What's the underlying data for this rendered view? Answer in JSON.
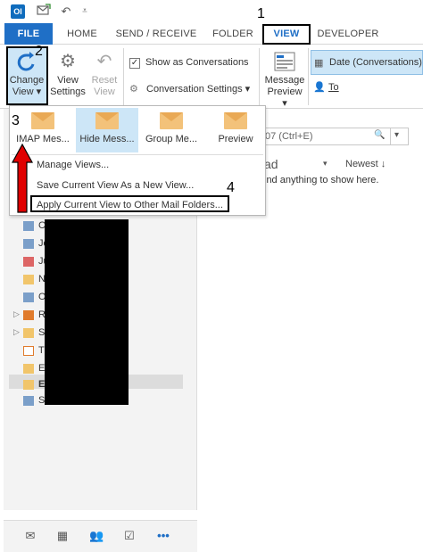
{
  "app": {
    "icon_label": "Ol"
  },
  "quick_access": {
    "undo_glyph": "↶",
    "customize_glyph": "⩡"
  },
  "tabs": [
    {
      "label": "FILE"
    },
    {
      "label": "HOME"
    },
    {
      "label": "SEND / RECEIVE"
    },
    {
      "label": "FOLDER"
    },
    {
      "label": "VIEW"
    },
    {
      "label": "DEVELOPER"
    }
  ],
  "ribbon": {
    "change_view": "Change View ▾",
    "view_settings": "View Settings",
    "reset_view": "Reset View",
    "show_as_conversations": "Show as Conversations",
    "conversation_settings": "Conversation Settings ▾",
    "message_preview": "Message Preview ▾",
    "arrangement_date": "Date (Conversations)",
    "arrangement_to": "To"
  },
  "dropdown": {
    "gallery": [
      {
        "label": "IMAP Mes..."
      },
      {
        "label": "Hide Mess..."
      },
      {
        "label": "Group Me..."
      },
      {
        "label": "Preview"
      }
    ],
    "manage_views": "Manage Views...",
    "save_current_view": "Save Current View As a New View...",
    "apply_current_view": "Apply Current View to Other Mail Folders..."
  },
  "message_list": {
    "search_placeholder": "07 (Ctrl+E)",
    "search_icon": "🔍",
    "sort_label": "ad",
    "sort_order": "Newest ↓",
    "empty_text": "ind anything to show here."
  },
  "nav_folders": [
    {
      "label": "C"
    },
    {
      "label": "Jo"
    },
    {
      "label": "Ju"
    },
    {
      "label": "N"
    },
    {
      "label": "O"
    },
    {
      "label": "R"
    },
    {
      "label": "Sy"
    },
    {
      "label": "T"
    },
    {
      "label": "El"
    },
    {
      "label": "Ex"
    },
    {
      "label": "Se"
    }
  ],
  "bottom_nav": {
    "more": "•••"
  },
  "annotations": [
    "1",
    "2",
    "3",
    "4"
  ],
  "colors": {
    "accent": "#1f6fc6",
    "selected": "#cde6f7",
    "arrow": "#e00000"
  }
}
